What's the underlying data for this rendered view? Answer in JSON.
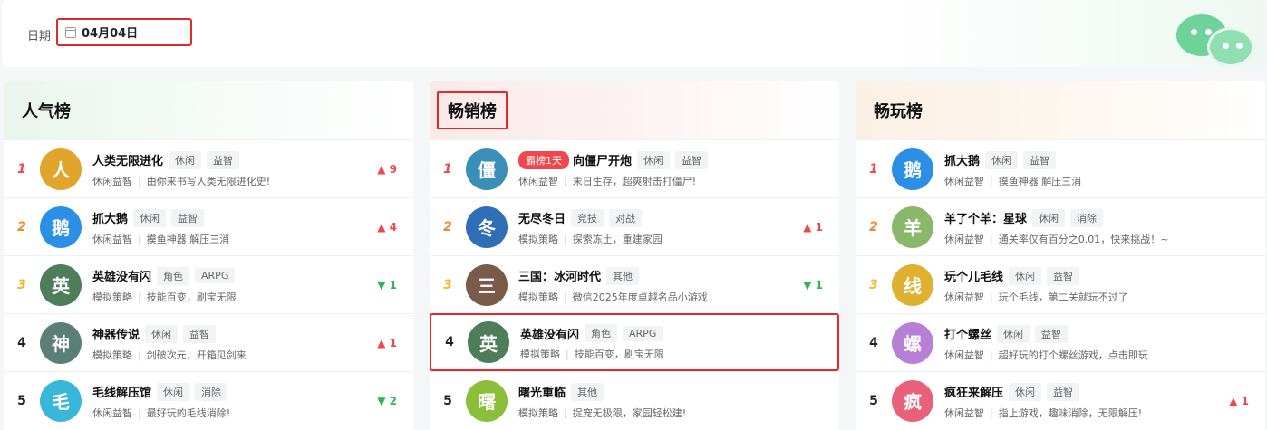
{
  "filter": {
    "date_label": "日期",
    "date_value": "04月04日"
  },
  "panels": [
    {
      "title": "人气榜",
      "rows": [
        {
          "rank": "1",
          "name": "人类无限进化",
          "tags": [
            "休闲",
            "益智"
          ],
          "category": "休闲益智",
          "desc": "由你来书写人类无限进化史!",
          "trend": "▲ 9",
          "dir": "up",
          "color": "#e0a52a",
          "glyph": "人"
        },
        {
          "rank": "2",
          "name": "抓大鹅",
          "tags": [
            "休闲",
            "益智"
          ],
          "category": "休闲益智",
          "desc": "摸鱼神器 解压三消",
          "trend": "▲ 4",
          "dir": "up",
          "color": "#2c8fe6",
          "glyph": "鹅"
        },
        {
          "rank": "3",
          "name": "英雄没有闪",
          "tags": [
            "角色",
            "ARPG"
          ],
          "category": "模拟策略",
          "desc": "技能百变，刷宝无限",
          "trend": "▼ 1",
          "dir": "down",
          "color": "#4e7d5a",
          "glyph": "英"
        },
        {
          "rank": "4",
          "name": "神器传说",
          "tags": [
            "休闲",
            "益智"
          ],
          "category": "模拟策略",
          "desc": "剑破次元，开箱见剑来",
          "trend": "▲ 1",
          "dir": "up",
          "color": "#5a7f76",
          "glyph": "神"
        },
        {
          "rank": "5",
          "name": "毛线解压馆",
          "tags": [
            "休闲",
            "消除"
          ],
          "category": "休闲益智",
          "desc": "最好玩的毛线消除!",
          "trend": "▼ 2",
          "dir": "down",
          "color": "#38b7d9",
          "glyph": "毛"
        }
      ]
    },
    {
      "title": "畅销榜",
      "rows": [
        {
          "rank": "1",
          "hot": "霸榜1天",
          "name": "向僵尸开炮",
          "tags": [
            "休闲",
            "益智"
          ],
          "category": "休闲益智",
          "desc": "末日生存，超爽射击打僵尸!",
          "trend": "",
          "dir": "up",
          "color": "#3a8fb8",
          "glyph": "僵"
        },
        {
          "rank": "2",
          "name": "无尽冬日",
          "tags": [
            "竞技",
            "对战"
          ],
          "category": "模拟策略",
          "desc": "探索冻土，重建家园",
          "trend": "▲ 1",
          "dir": "up",
          "color": "#2e6fb8",
          "glyph": "冬"
        },
        {
          "rank": "3",
          "name": "三国：冰河时代",
          "tags": [
            "其他"
          ],
          "category": "模拟策略",
          "desc": "微信2025年度卓越名品小游戏",
          "trend": "▼ 1",
          "dir": "down",
          "color": "#7a5a48",
          "glyph": "三"
        },
        {
          "rank": "4",
          "name": "英雄没有闪",
          "tags": [
            "角色",
            "ARPG"
          ],
          "category": "模拟策略",
          "desc": "技能百变，刷宝无限",
          "trend": "",
          "dir": "up",
          "color": "#4e7d5a",
          "glyph": "英"
        },
        {
          "rank": "5",
          "name": "曙光重临",
          "tags": [
            "其他"
          ],
          "category": "模拟策略",
          "desc": "捉宠无极限，家园轻松建!",
          "trend": "",
          "dir": "up",
          "color": "#8bbf3a",
          "glyph": "曙"
        }
      ]
    },
    {
      "title": "畅玩榜",
      "rows": [
        {
          "rank": "1",
          "name": "抓大鹅",
          "tags": [
            "休闲",
            "益智"
          ],
          "category": "休闲益智",
          "desc": "摸鱼神器 解压三消",
          "trend": "",
          "dir": "up",
          "color": "#2c8fe6",
          "glyph": "鹅"
        },
        {
          "rank": "2",
          "name": "羊了个羊：星球",
          "tags": [
            "休闲",
            "消除"
          ],
          "category": "休闲益智",
          "desc": "通关率仅有百分之0.01，快来挑战！~",
          "trend": "",
          "dir": "up",
          "color": "#8ab86a",
          "glyph": "羊"
        },
        {
          "rank": "3",
          "name": "玩个儿毛线",
          "tags": [
            "休闲",
            "益智"
          ],
          "category": "休闲益智",
          "desc": "玩个毛线，第二关就玩不过了",
          "trend": "",
          "dir": "up",
          "color": "#e0b030",
          "glyph": "线"
        },
        {
          "rank": "4",
          "name": "打个螺丝",
          "tags": [
            "休闲",
            "益智"
          ],
          "category": "休闲益智",
          "desc": "超好玩的打个螺丝游戏，点击即玩",
          "trend": "",
          "dir": "up",
          "color": "#b77fd6",
          "glyph": "螺"
        },
        {
          "rank": "5",
          "name": "疯狂来解压",
          "tags": [
            "休闲",
            "益智"
          ],
          "category": "休闲益智",
          "desc": "指上游戏，趣味消除，无限解压!",
          "trend": "▲ 1",
          "dir": "up",
          "color": "#e8607a",
          "glyph": "疯"
        }
      ]
    }
  ]
}
